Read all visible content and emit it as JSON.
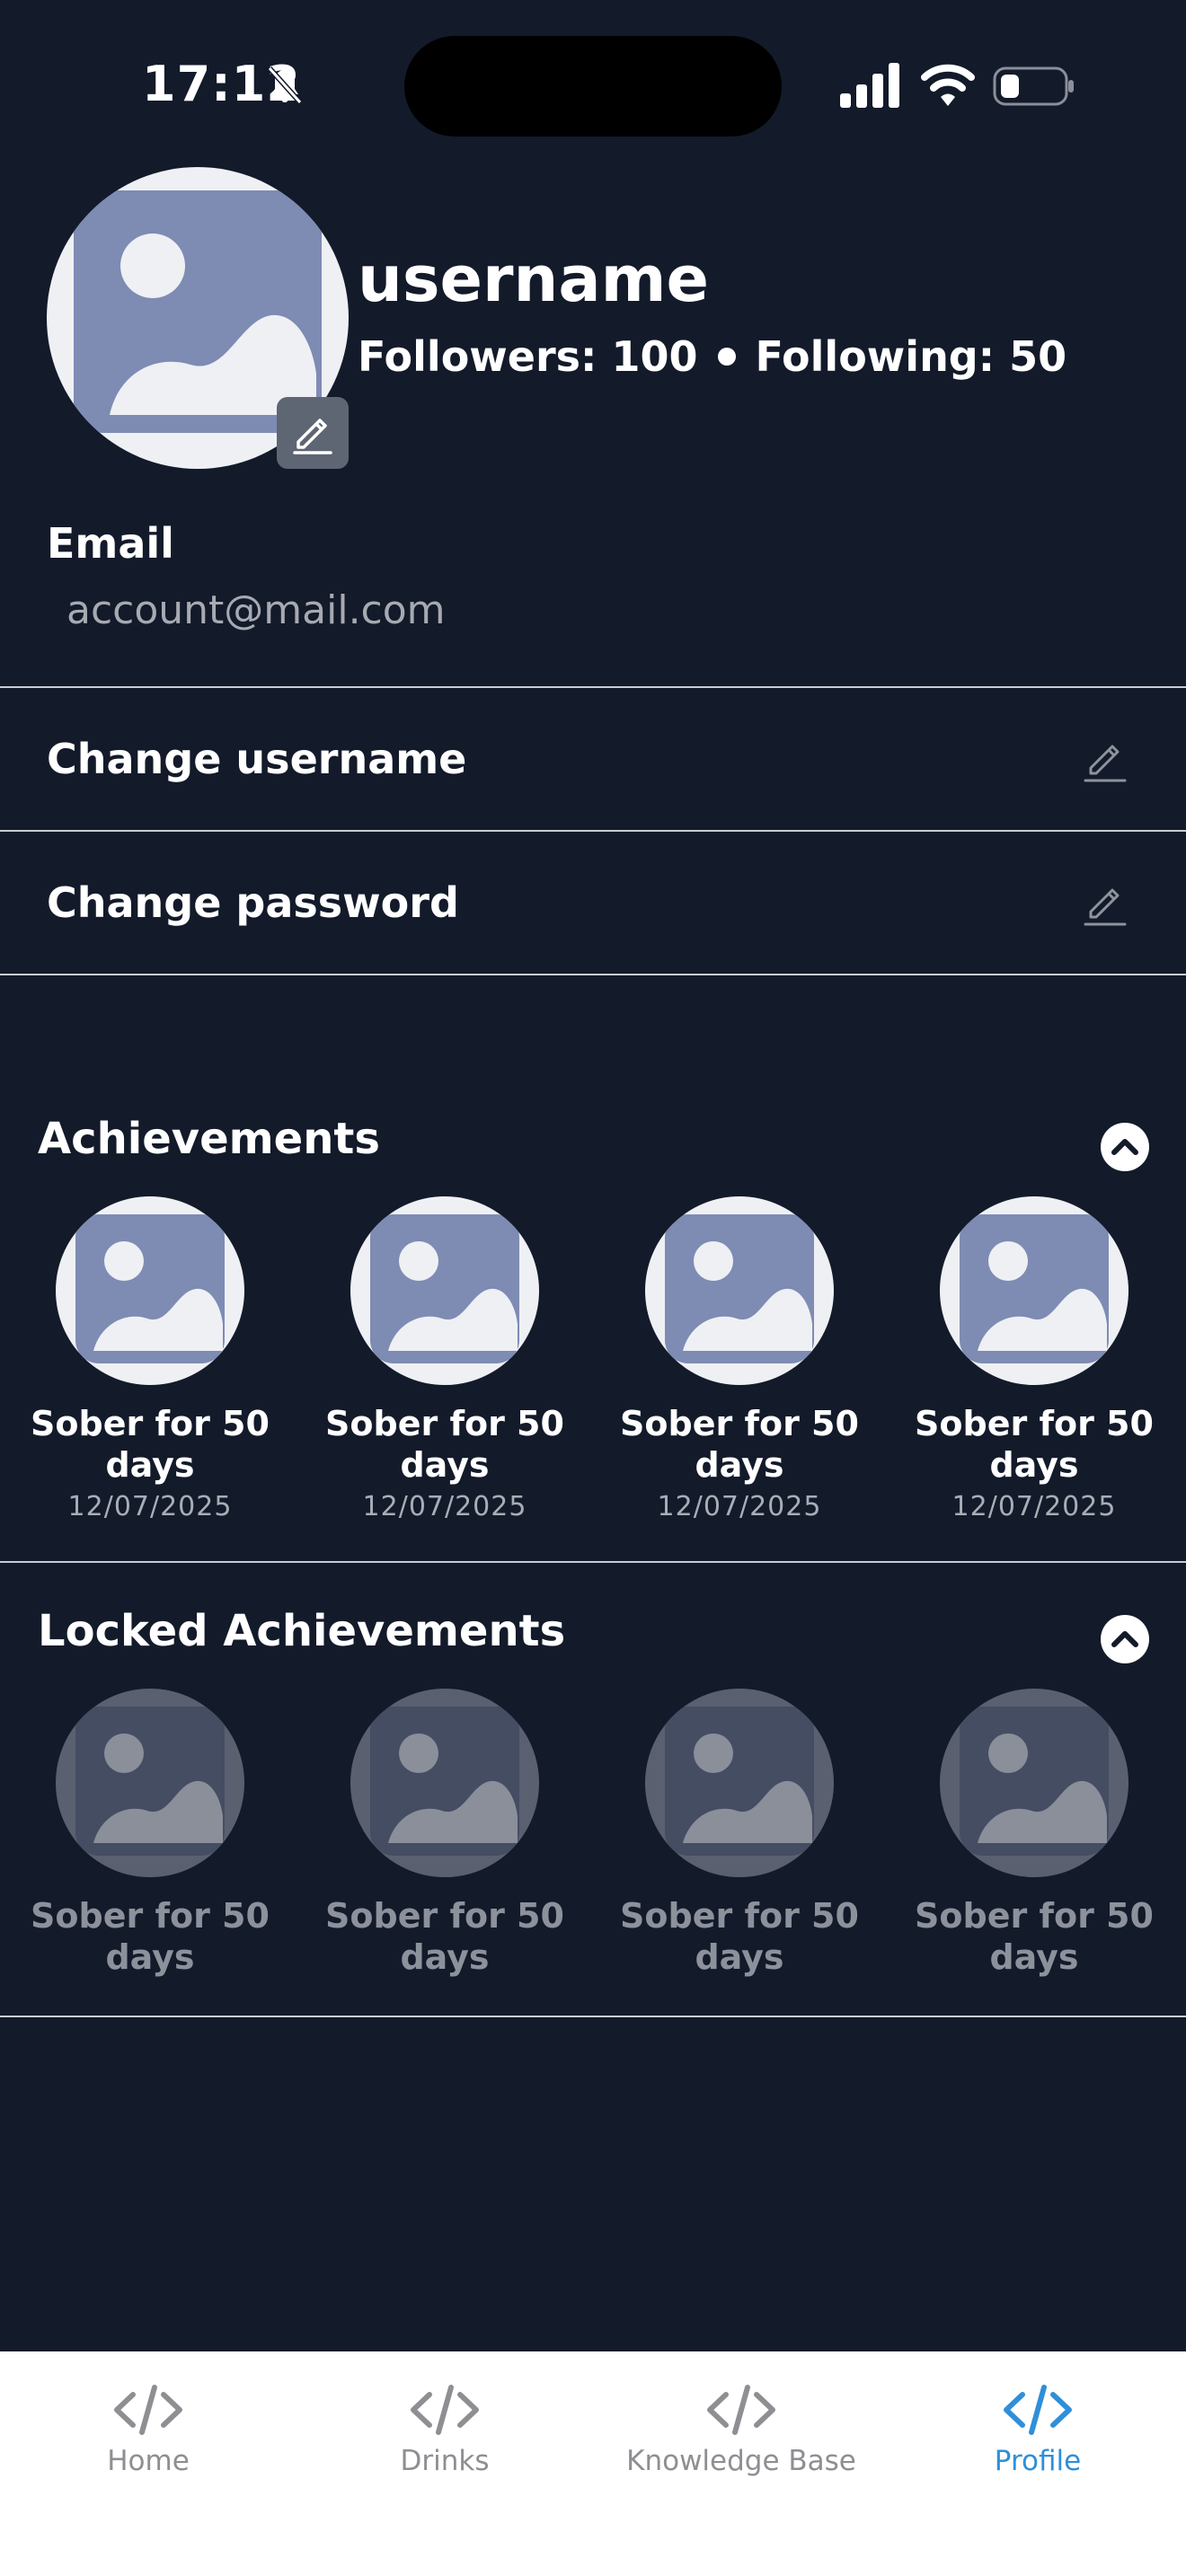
{
  "status_bar": {
    "time": "17:12"
  },
  "profile": {
    "username": "username",
    "followers_text": "Followers: 100",
    "following_text": "Following: 50",
    "email_label": "Email",
    "email_value": "account@mail.com"
  },
  "settings": [
    {
      "label": "Change username",
      "icon": "pencil-icon"
    },
    {
      "label": "Change password",
      "icon": "pencil-icon"
    }
  ],
  "achievements": {
    "title": "Achievements",
    "items": [
      {
        "name": "Sober for 50 days",
        "date": "12/07/2025"
      },
      {
        "name": "Sober for 50 days",
        "date": "12/07/2025"
      },
      {
        "name": "Sober for 50 days",
        "date": "12/07/2025"
      },
      {
        "name": "Sober for 50 days",
        "date": "12/07/2025"
      }
    ]
  },
  "locked_achievements": {
    "title": "Locked Achievements",
    "items": [
      {
        "name": "Sober for 50 days"
      },
      {
        "name": "Sober for 50 days"
      },
      {
        "name": "Sober for 50 days"
      },
      {
        "name": "Sober for 50 days"
      }
    ]
  },
  "tabbar": {
    "tabs": [
      {
        "label": "Home",
        "icon": "code-icon",
        "active": false
      },
      {
        "label": "Drinks",
        "icon": "code-icon",
        "active": false
      },
      {
        "label": "Knowledge Base",
        "icon": "code-icon",
        "active": false
      },
      {
        "label": "Profile",
        "icon": "code-icon",
        "active": true
      }
    ]
  },
  "colors": {
    "background": "#131a2a",
    "accent": "#2f8fd8",
    "placeholder": "#7e8bb3"
  }
}
